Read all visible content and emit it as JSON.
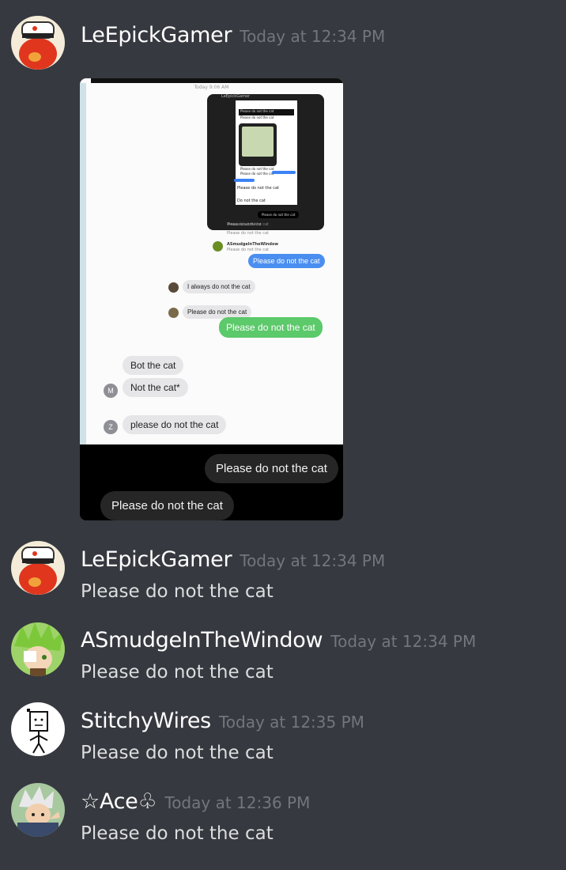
{
  "messages": [
    {
      "username": "LeEpickGamer",
      "timestamp": "Today at 12:34 PM",
      "attachment": {
        "time_label": "Today 9:06 AM",
        "nested": {
          "author": "LeEpickGamer",
          "line_a": "Please do not the cat",
          "line_b": "Please do not the cat",
          "map_caption": "Please do not the cat",
          "line_c": "Please do not the cat",
          "text_1": "Please do not the cat",
          "text_2": "Do not the cat",
          "pill": "Please do not the cat",
          "bottom": "Please do not the cat"
        },
        "below_nested_1": "Please do not the cat",
        "below_nested_2": "Please do not the cat",
        "smudge_name": "ASmudgeInTheWindow",
        "smudge_sub": "Please do not the cat",
        "blue_bubble": "Please do not the cat",
        "grey_1": "I always do not the cat",
        "grey_2": "Please do not the cat",
        "green_bubble": "Please do not the cat",
        "grey_3": "Bot the cat",
        "grey_4": "Not the cat*",
        "avatar_m": "M",
        "avatar_z": "Z",
        "grey_5": "please do not the cat",
        "dark_right": "Please do not the cat",
        "dark_left": "Please do not the cat"
      }
    },
    {
      "username": "LeEpickGamer",
      "timestamp": "Today at 12:34 PM",
      "text": "Please do not the cat"
    },
    {
      "username": "ASmudgeInTheWindow",
      "timestamp": "Today at 12:34 PM",
      "text": "Please do not the cat"
    },
    {
      "username": "StitchyWires",
      "timestamp": "Today at 12:35 PM",
      "text": "Please do not the cat"
    },
    {
      "username": "☆Ace♧",
      "timestamp": "Today at 12:36 PM",
      "text": "Please do not the cat"
    }
  ],
  "colors": {
    "background": "#36393f",
    "username": "#ffffff",
    "timestamp": "#72767d",
    "message_text": "#dcddde"
  }
}
